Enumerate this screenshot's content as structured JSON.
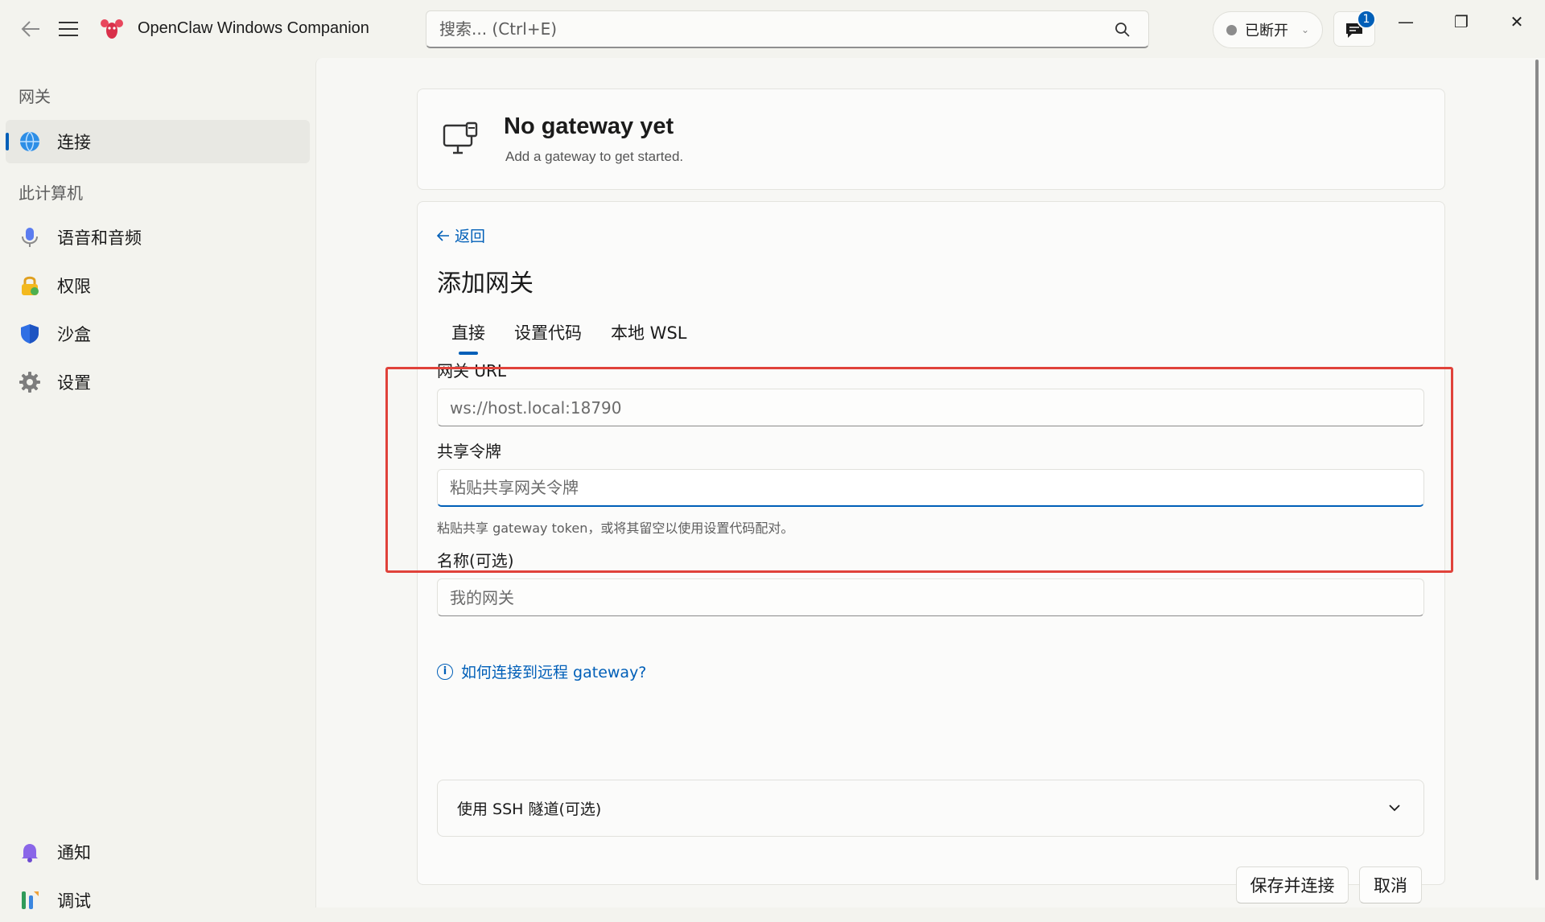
{
  "window": {
    "title": "OpenClaw Windows Companion",
    "minimize": "—",
    "restore": "❐",
    "close": "✕"
  },
  "search": {
    "placeholder": "搜索... (Ctrl+E)"
  },
  "status": {
    "label": "已断开",
    "dot_color": "#8c8c8c"
  },
  "notifications": {
    "count": "1"
  },
  "sidebar": {
    "section_gateway": "网关",
    "section_computer": "此计算机",
    "items": [
      {
        "label": "连接",
        "icon": "globe-icon",
        "active": true
      },
      {
        "label": "语音和音频",
        "icon": "microphone-icon"
      },
      {
        "label": "权限",
        "icon": "lock-icon"
      },
      {
        "label": "沙盒",
        "icon": "shield-icon"
      },
      {
        "label": "设置",
        "icon": "gear-icon"
      },
      {
        "label": "通知",
        "icon": "bell-icon"
      },
      {
        "label": "调试",
        "icon": "tools-icon"
      }
    ]
  },
  "gateway_card": {
    "title": "No gateway yet",
    "subtitle": "Add a gateway to get started."
  },
  "form": {
    "back_label": "返回",
    "title": "添加网关",
    "tabs": [
      "直接",
      "设置代码",
      "本地 WSL"
    ],
    "active_tab": "直接",
    "url_label": "网关 URL",
    "url_placeholder": "ws://host.local:18790",
    "token_label": "共享令牌",
    "token_placeholder": "粘贴共享网关令牌",
    "token_hint": "粘贴共享 gateway token，或将其留空以使用设置代码配对。",
    "name_label": "名称(可选)",
    "name_placeholder": "我的网关",
    "help_link": "如何连接到远程 gateway?",
    "ssh_expander": "使用 SSH 隧道(可选)",
    "save_button": "保存并连接",
    "cancel_button": "取消"
  },
  "colors": {
    "accent": "#005fb8",
    "highlight": "#e0423a"
  }
}
